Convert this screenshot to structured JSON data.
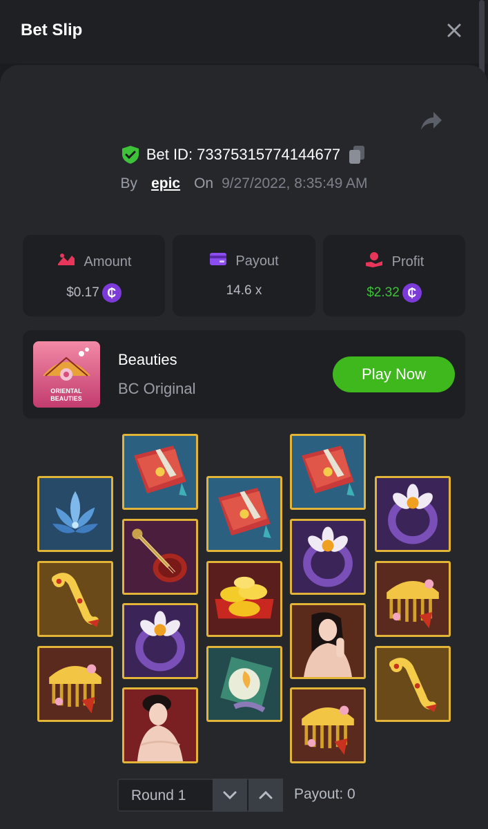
{
  "header": {
    "title": "Bet Slip"
  },
  "bet": {
    "id_label": "Bet ID: 73375315774144677",
    "by_label": "By",
    "user": "epic",
    "on_label": "On",
    "date": "9/27/2022, 8:35:49 AM"
  },
  "stats": {
    "amount": {
      "label": "Amount",
      "value": "$0.17",
      "coin": "₵"
    },
    "payout": {
      "label": "Payout",
      "value": "14.6 x"
    },
    "profit": {
      "label": "Profit",
      "value": "$2.32",
      "coin": "₵"
    }
  },
  "game": {
    "name": "Beauties",
    "provider": "BC Original",
    "play_label": "Play Now",
    "thumb_text": "ORIENTAL BEAUTIES"
  },
  "reels": {
    "symbols": [
      [
        "lotus",
        "scroll",
        "ring",
        "comb"
      ],
      [
        "book",
        "lute",
        "ring",
        "lady"
      ],
      [
        "book",
        "gold",
        "fan"
      ],
      [
        "book",
        "ring",
        "lady",
        "comb"
      ],
      [
        "ring",
        "comb",
        "scroll"
      ]
    ]
  },
  "round": {
    "label": "Round 1",
    "payout": "Payout: 0"
  },
  "colors": {
    "accent_green": "#3fb81d",
    "coin_purple": "#7c3bd8",
    "tile_border": "#e2b437",
    "profit_green": "#3ec23a"
  },
  "icons": {
    "close": "close-icon",
    "share": "share-icon",
    "shield": "shield-check-icon",
    "copy": "copy-icon",
    "amount": "amount-icon",
    "payout": "wallet-icon",
    "profit": "profit-hand-icon",
    "down": "chevron-down-icon",
    "up": "chevron-up-icon"
  }
}
